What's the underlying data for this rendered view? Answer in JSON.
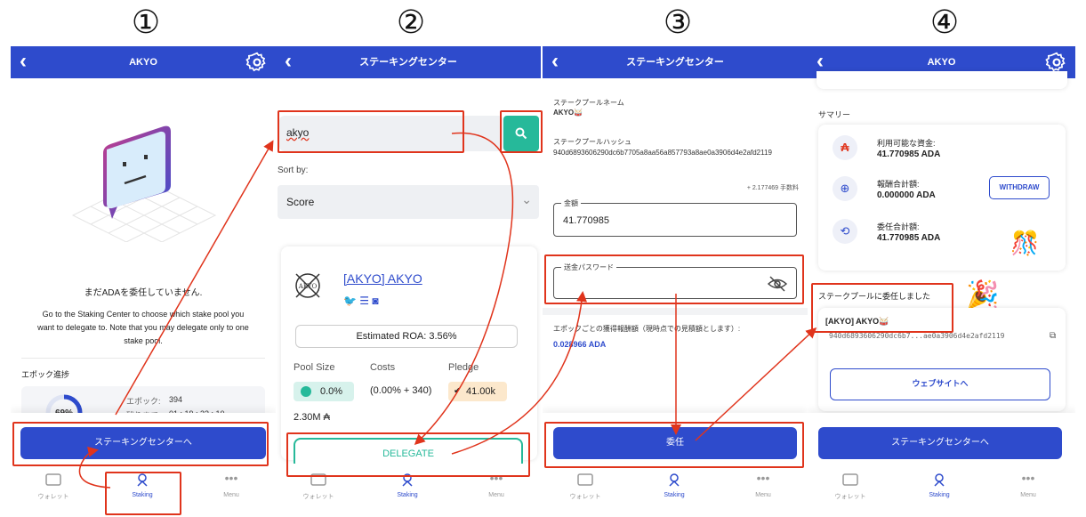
{
  "steps": [
    "①",
    "②",
    "③",
    "④"
  ],
  "nav": {
    "wallet": "ウォレット",
    "staking": "Staking",
    "menu": "Menu"
  },
  "panel1": {
    "title": "AKYO",
    "not_delegated": "まだADAを委任していません.",
    "instructions": "Go to the Staking Center to choose which stake pool you want to delegate to. Note that you may delegate only to one stake pool.",
    "epoch_header": "エポック進捗",
    "epoch_percent": "69%",
    "epoch_label": "エポック:",
    "epoch_value": "394",
    "remaining_label": "残りまで:",
    "remaining_value": "01 : 19 : 33 : 10",
    "staking_center_button": "ステーキングセンターへ"
  },
  "panel2": {
    "title": "ステーキングセンター",
    "search_value": "akyo",
    "sort_label": "Sort by:",
    "sort_value": "Score",
    "pool_name": "[AKYO] AKYO",
    "pool_logo_text": "AKYO",
    "estimated_roa": "Estimated ROA: 3.56%",
    "pool_size_label": "Pool Size",
    "costs_label": "Costs",
    "pledge_label": "Pledge",
    "pool_size_value": "0.0%",
    "costs_value": "(0.00% + 340)",
    "pledge_value": "41.00k",
    "total_stake": "2.30M ₳",
    "delegate_button": "DELEGATE"
  },
  "panel3": {
    "title": "ステーキングセンター",
    "pool_name_label": "ステークプールネーム",
    "pool_name_value": "AKYO🥁",
    "pool_hash_label": "ステークプールハッシュ",
    "pool_hash_value": "940d6893606290dc6b7705a8aa56a857793a8ae0a3906d4e2afd2119",
    "fee_note": "+ 2.177469 手数料",
    "amount_label": "金額",
    "amount_value": "41.770985",
    "password_label": "送金パスワード",
    "reward_note": "エポックごとの獲得報酬額（現時点での見積額とします）:",
    "reward_value": "0.028966 ADA",
    "delegate_button": "委任"
  },
  "panel4": {
    "title": "AKYO",
    "summary_header": "サマリー",
    "available_label": "利用可能な資金:",
    "available_value": "41.770985 ADA",
    "rewards_label": "報酬合計額:",
    "rewards_value": "0.000000 ADA",
    "withdraw_button": "WITHDRAW",
    "delegated_label": "委任合計額:",
    "delegated_value": "41.770985 ADA",
    "delegated_notice": "ステークプールに委任しました",
    "pool_name": "[AKYO] AKYO🥁",
    "pool_hash_short": "940d6893606290dc6b7...ae0a3906d4e2afd2119",
    "website_button": "ウェブサイトへ",
    "staking_center_button": "ステーキングセンターへ"
  },
  "colors": {
    "primary": "#2e4bcc",
    "accent_teal": "#26b99a",
    "annotation_red": "#e0341c"
  }
}
